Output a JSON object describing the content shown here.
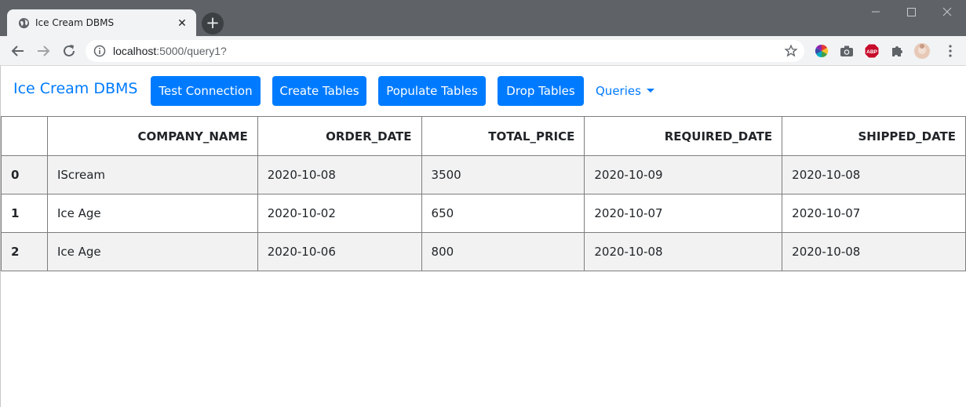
{
  "browser": {
    "tab_title": "Ice Cream DBMS",
    "url_host": "localhost",
    "url_path": ":5000/query1?",
    "extensions": [
      "color-picker-icon",
      "camera-icon",
      "adblock-icon",
      "puzzle-icon",
      "profile-avatar",
      "kebab-menu-icon"
    ]
  },
  "navbar": {
    "brand": "Ice Cream DBMS",
    "buttons": [
      "Test Connection",
      "Create Tables",
      "Populate Tables",
      "Drop Tables"
    ],
    "dropdown_label": "Queries"
  },
  "table": {
    "columns": [
      "",
      "COMPANY_NAME",
      "ORDER_DATE",
      "TOTAL_PRICE",
      "REQUIRED_DATE",
      "SHIPPED_DATE"
    ],
    "rows": [
      {
        "index": "0",
        "cells": [
          "IScream",
          "2020-10-08",
          "3500",
          "2020-10-09",
          "2020-10-08"
        ]
      },
      {
        "index": "1",
        "cells": [
          "Ice Age",
          "2020-10-02",
          "650",
          "2020-10-07",
          "2020-10-07"
        ]
      },
      {
        "index": "2",
        "cells": [
          "Ice Age",
          "2020-10-06",
          "800",
          "2020-10-08",
          "2020-10-08"
        ]
      }
    ]
  },
  "colors": {
    "primary": "#007bff",
    "chrome_dark": "#5f6368",
    "chrome_light": "#f1f3f4",
    "row_stripe": "#f2f2f2"
  }
}
